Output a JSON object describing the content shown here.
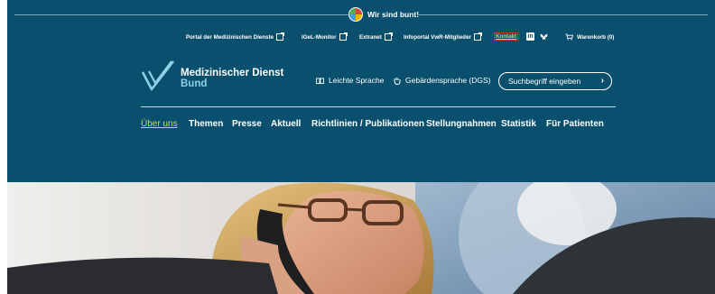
{
  "banner": {
    "text": "Wir sind bunt!"
  },
  "service_links": [
    {
      "label": "Portal der Medizinischen Dienste",
      "external": true
    },
    {
      "label": "IGeL-Monitor",
      "external": true
    },
    {
      "label": "Extranet",
      "external": true
    },
    {
      "label": "Infoportal VwR-Mitglieder",
      "external": true
    },
    {
      "label": "Kontakt",
      "external": false
    }
  ],
  "social": {
    "linkedin_icon": "linkedin-icon",
    "bluesky_icon": "bluesky-icon"
  },
  "cart": {
    "label": "Warenkorb (0)"
  },
  "logo": {
    "line1": "Medizinischer Dienst",
    "line2": "Bund"
  },
  "utility": {
    "leichte_sprache": "Leichte Sprache",
    "gebaerdensprache": "Gebärdensprache (DGS)"
  },
  "search": {
    "placeholder": "Suchbegriff eingeben"
  },
  "nav": {
    "items": [
      "Über uns",
      "Themen",
      "Presse",
      "Aktuell",
      "Richtlinien / Publikationen",
      "Stellungnahmen",
      "Statistik",
      "Für Patienten"
    ],
    "active_index": 0
  },
  "colors": {
    "header": "#08506d",
    "accent": "#c9d96a",
    "logo_light": "#8fd0e6"
  }
}
